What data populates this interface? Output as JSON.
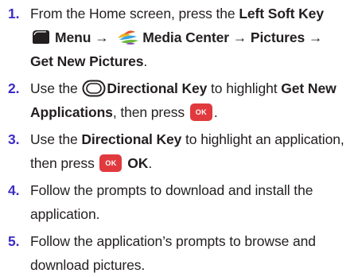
{
  "steps": [
    {
      "number": "1.",
      "t1": "From the Home screen, press the ",
      "b1": "Left Soft Key",
      "b2": "Menu",
      "arrow": "→",
      "b3": "Media Center",
      "b4": "Pictures",
      "b5": "Get New Pictures",
      "t_end": "."
    },
    {
      "number": "2.",
      "t1": "Use the ",
      "b1": "Directional Key",
      "t2": " to highlight ",
      "b2": "Get New Applications",
      "t3": ", then press ",
      "ok_icon": "OK",
      "t_end": "."
    },
    {
      "number": "3.",
      "t1": "Use the ",
      "b1": "Directional Key",
      "t2": " to highlight an application, then press ",
      "ok_icon": "OK",
      "b2": "OK",
      "t_end": "."
    },
    {
      "number": "4.",
      "text": "Follow the prompts to download and install the application."
    },
    {
      "number": "5.",
      "text": "Follow the application’s prompts to browse and download pictures."
    }
  ],
  "icons": {
    "soft_key": "left-soft-key-icon",
    "media_center": "media-center-icon",
    "directional_key": "directional-key-icon",
    "ok_key": "ok-key-icon"
  },
  "colors": {
    "step_number": "#3c2cc4",
    "ok_key": "#e03a3e",
    "text": "#231f20"
  }
}
